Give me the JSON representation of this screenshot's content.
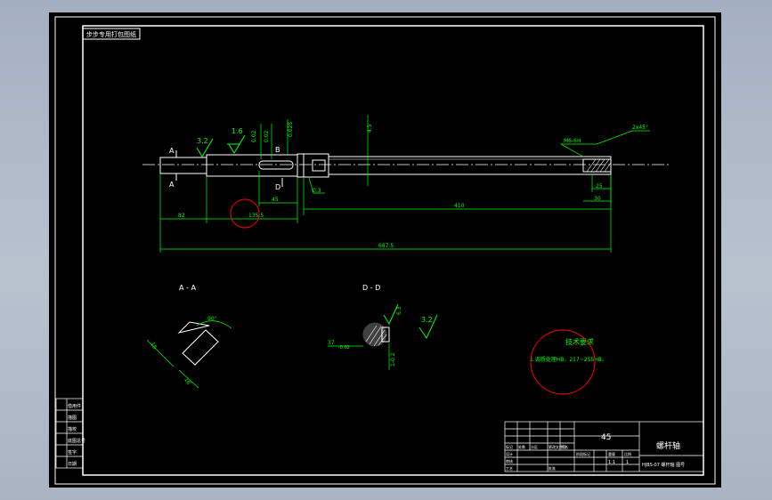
{
  "top_label": "步步专用打包图纸",
  "section_labels": {
    "a": "A - A",
    "d": "D - D"
  },
  "main_view": {
    "roughness_top": "3.2",
    "roughness_2": "1.6",
    "section_letter_a": "A",
    "section_letter_d": "D",
    "letter_b": "B",
    "note_top_1": "0.02",
    "note_top_2": "0.02",
    "note_top_3": "0.025",
    "note_top_4": "4.5",
    "note_sm_1": "0.3",
    "thread_label": "M6-6H",
    "chamfer": "2x45°",
    "dim_left": "82",
    "dim_center": "135.5",
    "dim_45": "45",
    "dim_main": "410",
    "dim_overall": "687.5",
    "dim_right_1": "25",
    "dim_right_2": "30"
  },
  "section_a_notes": {
    "angle": "90°",
    "dim_1": "15",
    "dim_2": "16"
  },
  "section_d_notes": {
    "diameter": "37",
    "tolerance": "-0.02",
    "roughness": "3.2",
    "depth": "6.3",
    "keyway": "1-0.2"
  },
  "tech_req": {
    "title": "技术要求",
    "line1": "1.调质处理HB，217~255HB。"
  },
  "title_block": {
    "material": "45",
    "part_name": "螺杆轴",
    "drawing_no": "HJBS-07 螺杆轴 图号",
    "scale": "1:1",
    "sheet": "1",
    "row_labels": [
      "标记",
      "处数",
      "分区",
      "更改文件号",
      "签名",
      "年月日"
    ],
    "col_labels": [
      "阶段标记",
      "重量",
      "比例"
    ],
    "sign_labels": [
      "设计",
      "审核",
      "工艺",
      "批准"
    ]
  },
  "side_table": {
    "rows": [
      "借用件",
      "描图",
      "描校",
      "底图总号",
      "签字",
      "日期"
    ]
  },
  "colors": {
    "line": "#ffffff",
    "dim": "#00ff00",
    "highlight": "#ff0000",
    "canvas": "#000000"
  }
}
